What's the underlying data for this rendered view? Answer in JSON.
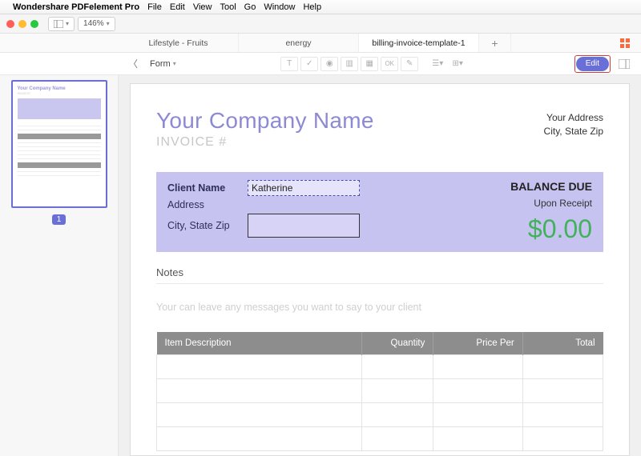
{
  "menubar": {
    "app": "Wondershare PDFelement Pro",
    "items": [
      "File",
      "Edit",
      "View",
      "Tool",
      "Go",
      "Window",
      "Help"
    ]
  },
  "titlebar": {
    "zoom": "146%"
  },
  "tabs": {
    "items": [
      "Lifestyle - Fruits",
      "energy",
      "billing-invoice-template-1"
    ],
    "active_index": 2
  },
  "toolbar": {
    "form_label": "Form",
    "edit_label": "Edit"
  },
  "sidebar": {
    "page_number": "1",
    "thumb_company": "Your Company Name",
    "thumb_invoice": "INVOICE"
  },
  "doc": {
    "company": "Your Company Name",
    "invoice_label": "INVOICE #",
    "your_address": "Your Address",
    "your_csz": "City, State Zip",
    "client_name_label": "Client Name",
    "client_name_value": "Katherine",
    "address_label": "Address",
    "csz_label": "City, State Zip",
    "balance_due": "BALANCE DUE",
    "upon_receipt": "Upon Receipt",
    "amount": "$0.00",
    "notes_heading": "Notes",
    "notes_placeholder": "Your can leave any messages you want to say to your client",
    "cols": {
      "desc": "Item Description",
      "qty": "Quantity",
      "price": "Price Per",
      "total": "Total"
    }
  }
}
